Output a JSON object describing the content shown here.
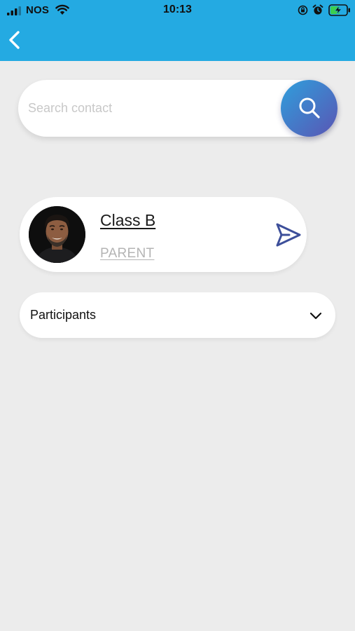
{
  "status_bar": {
    "carrier": "NOS",
    "time": "10:13",
    "icons": [
      "signal-icon",
      "wifi-icon",
      "rotation-lock-icon",
      "alarm-icon",
      "battery-charging-icon"
    ]
  },
  "nav": {
    "back_icon": "chevron-left-icon",
    "background_color": "#24aae2"
  },
  "search": {
    "placeholder": "Search contact",
    "value": "",
    "button_icon": "search-icon",
    "button_gradient": [
      "#2f9fdc",
      "#5a55b4"
    ]
  },
  "contact": {
    "name": "Class B",
    "role": "PARENT",
    "action_icon": "send-icon"
  },
  "participants": {
    "label": "Participants",
    "icon": "chevron-down-icon"
  },
  "colors": {
    "background": "#ececec",
    "accent": "#24aae2",
    "send_icon": "#3d4f9a"
  }
}
